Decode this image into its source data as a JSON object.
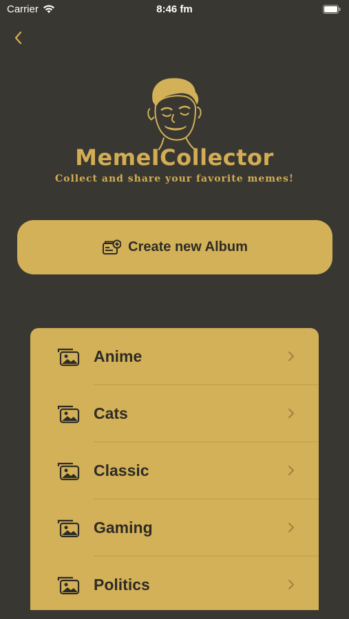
{
  "status_bar": {
    "carrier": "Carrier",
    "time": "8:46 fm"
  },
  "header": {
    "app_name": "MemeICollector",
    "tagline": "Collect and share your favorite memes!"
  },
  "actions": {
    "create_album_label": "Create new Album"
  },
  "albums": [
    {
      "label": "Anime"
    },
    {
      "label": "Cats"
    },
    {
      "label": "Classic"
    },
    {
      "label": "Gaming"
    },
    {
      "label": "Politics"
    }
  ],
  "colors": {
    "background": "#393731",
    "accent": "#d3b158",
    "text_dark": "#2e2b25"
  },
  "icons": {
    "back": "chevron-left-icon",
    "create": "album-add-icon",
    "album": "photo-stack-icon",
    "disclosure": "chevron-right-icon"
  }
}
